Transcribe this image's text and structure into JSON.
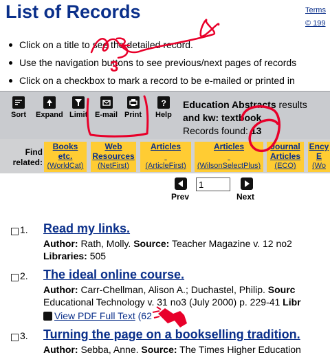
{
  "header": {
    "title": "List of Records",
    "links": [
      "Terms",
      "© 199"
    ]
  },
  "instructions": [
    "Click on a title to see the detailed record.",
    "Use the navigation buttons to see previous/next pages of records",
    "Click on a checkbox to mark a record to be e-mailed or printed in"
  ],
  "toolbar": {
    "sort": "Sort",
    "expand": "Expand",
    "limit": "Limit",
    "email": "E-mail",
    "print": "Print",
    "help": "Help"
  },
  "results": {
    "database": "Education Abstracts",
    "results_word": "results",
    "query": "and kw: textbook",
    "found_label": "Records found:",
    "found_count": "13"
  },
  "related": {
    "label_line1": "Find",
    "label_line2": "related:",
    "items": [
      {
        "l1": "Books",
        "l2": "etc.",
        "sub": "(WorldCat)"
      },
      {
        "l1": "Web",
        "l2": "Resources",
        "sub": "(NetFirst)"
      },
      {
        "l1": "Articles",
        "l2": "",
        "sub": "(ArticleFirst)"
      },
      {
        "l1": "Articles",
        "l2": "",
        "sub": "(WilsonSelectPlus)"
      },
      {
        "l1": "Journal",
        "l2": "Articles",
        "sub": "(ECO)"
      },
      {
        "l1": "Ency",
        "l2": "E",
        "sub": "(Wo"
      }
    ]
  },
  "pager": {
    "prev": "Prev",
    "next": "Next",
    "page_value": "1"
  },
  "records": [
    {
      "num": "1.",
      "title": "Read my links.",
      "author_label": "Author:",
      "author": "Rath, Molly.",
      "source_label": "Source:",
      "source": "Teacher Magazine v. 12 no2",
      "libraries_label": "Libraries:",
      "libraries": "505"
    },
    {
      "num": "2.",
      "title": "The ideal online course.",
      "author_label": "Author:",
      "author": "Carr-Chellman, Alison A.; Duchastel, Philip.",
      "source_label": "Sourc",
      "source_cont": "Educational Technology v. 31 no3 (July 2000) p. 229-41",
      "libraries_label": "Libr",
      "pdf": "View PDF Full Text",
      "pdf_size": "(62"
    },
    {
      "num": "3.",
      "title": "Turning the page on a bookselling tradition.",
      "author_label": "Author:",
      "author": "Sebba, Anne.",
      "source_label": "Source:",
      "source": "The Times Higher Education"
    }
  ],
  "annotation": {
    "number": "3",
    "color": "#e8002a"
  }
}
